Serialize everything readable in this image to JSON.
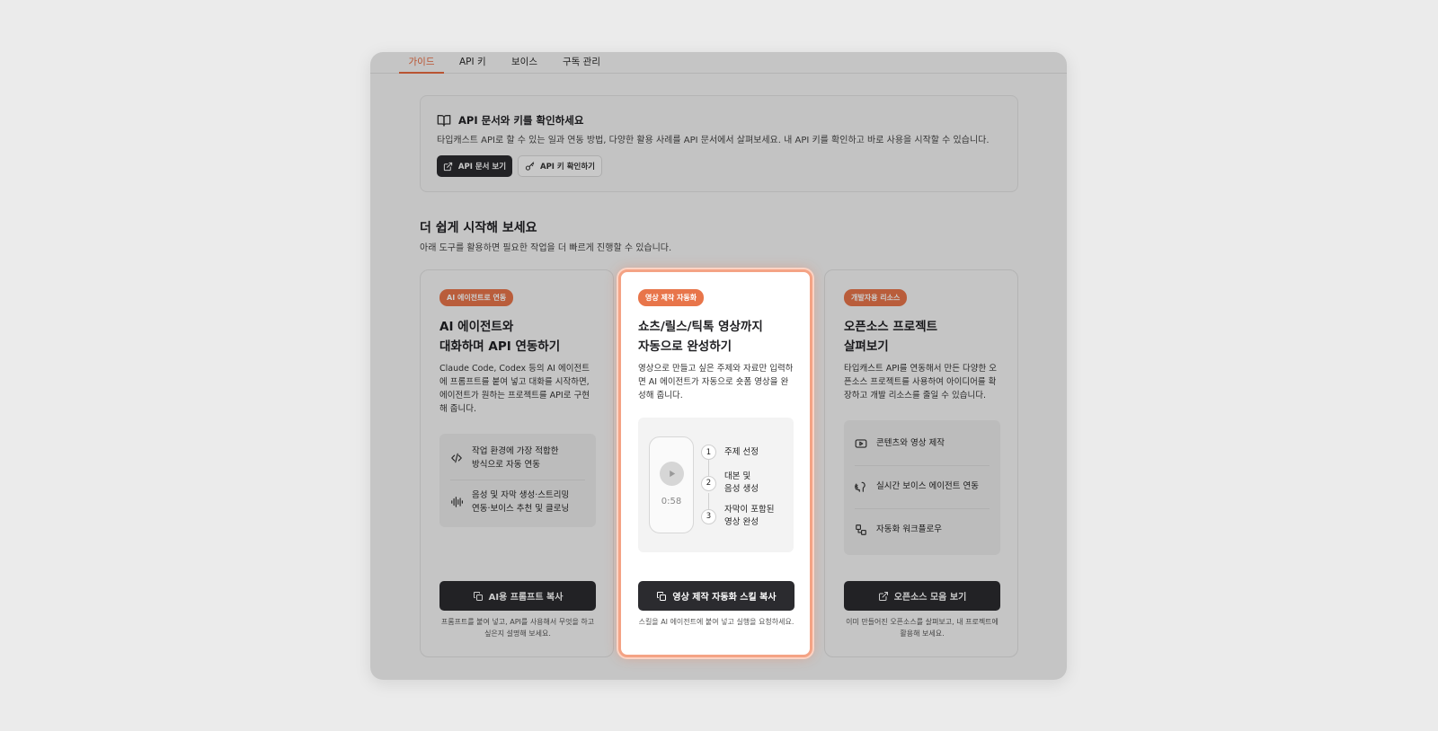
{
  "tabs": [
    {
      "label": "가이드",
      "active": true
    },
    {
      "label": "API 키"
    },
    {
      "label": "보이스"
    },
    {
      "label": "구독 관리"
    }
  ],
  "notice": {
    "icon": "book-open-icon",
    "title": "API 문서와 키를 확인하세요",
    "description": "타입캐스트 API로 할 수 있는 일과 연동 방법, 다양한 활용 사례를 API 문서에서 살펴보세요. 내 API 키를 확인하고 바로 사용을 시작할 수 있습니다.",
    "docs_button": "API 문서 보기",
    "key_button": "API 키 확인하기"
  },
  "section": {
    "title": "더 쉽게 시작해 보세요",
    "subtitle": "아래 도구를 활용하면 필요한 작업을 더 빠르게 진행할 수 있습니다."
  },
  "cards": [
    {
      "badge": "AI 에이전트로 연동",
      "title_line1": "AI 에이전트와",
      "title_line2": "대화하며 API 연동하기",
      "description": "Claude Code, Codex 등의 AI 에이전트에 프롬프트를 붙여 넣고 대화를 시작하면, 에이전트가 원하는 프로젝트를 API로 구현해 줍니다.",
      "features": [
        {
          "icon": "code-icon",
          "line1": "작업 환경에 가장 적합한",
          "line2": "방식으로 자동 연동"
        },
        {
          "icon": "waveform-icon",
          "line1": "음성 및 자막 생성·스트리밍",
          "line2": "연동·보이스 추천 및 클로닝"
        }
      ],
      "button": "AI용 프롬프트 복사",
      "note": "프롬프트를 붙여 넣고, API를 사용해서 무엇을 하고 싶은지 설명해 보세요."
    },
    {
      "badge": "영상 제작 자동화",
      "title_line1": "쇼츠/릴스/틱톡 영상까지",
      "title_line2": "자동으로 완성하기",
      "description": "영상으로 만들고 싶은 주제와 자료만 입력하면 AI 에이전트가 자동으로 숏폼 영상을 완성해 줍니다.",
      "video_time": "0:58",
      "steps": [
        {
          "num": "1",
          "line1": "주제 선정",
          "line2": ""
        },
        {
          "num": "2",
          "line1": "대본 및",
          "line2": "음성 생성"
        },
        {
          "num": "3",
          "line1": "자막이 포함된",
          "line2": "영상 완성"
        }
      ],
      "button": "영상 제작 자동화 스킬 복사",
      "note": "스킬을 AI 에이전트에 붙여 넣고 실행을 요청하세요."
    },
    {
      "badge": "개발자용 리소스",
      "title_line1": "오픈소스 프로젝트",
      "title_line2": "살펴보기",
      "description": "타입캐스트 API를 연동해서 만든 다양한 오픈소스 프로젝트를 사용하여 아이디어를 확장하고 개발 리소스를 줄일 수 있습니다.",
      "features": [
        {
          "icon": "youtube-icon",
          "label": "콘텐츠와 영상 제작"
        },
        {
          "icon": "voice-agent-icon",
          "label": "실시간 보이스 에이전트 연동"
        },
        {
          "icon": "workflow-icon",
          "label": "자동화 워크플로우"
        }
      ],
      "button": "오픈소스 모음 보기",
      "note": "이미 만들어진 오픈소스를 살펴보고, 내 프로젝트에 활용해 보세요."
    }
  ],
  "colors": {
    "accent": "#e8754a",
    "dark_button": "#2b2b2f",
    "highlight_border": "#f4a385"
  }
}
